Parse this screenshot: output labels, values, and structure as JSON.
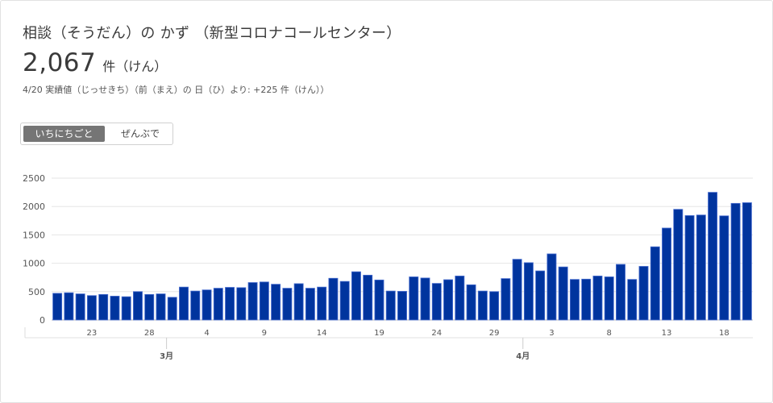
{
  "header": {
    "title": "相談（そうだん）の かず （新型コロナコールセンター）",
    "total_value": "2,067",
    "total_unit": "件（けん）",
    "subline": "4/20 実績値（じっせきち）（前（まえ）の 日（ひ）より: +225 件（けん））"
  },
  "toggle": {
    "daily_label": "いちにちごと",
    "cumulative_label": "ぜんぶで",
    "selected": "daily"
  },
  "colors": {
    "bar": "#00349e",
    "bar_stroke": "#4a6fd0",
    "grid": "#e6e6e6"
  },
  "chart_data": {
    "type": "bar",
    "title": "",
    "xlabel": "",
    "ylabel": "",
    "ylim": [
      0,
      2500
    ],
    "yticks": [
      0,
      500,
      1000,
      1500,
      2000,
      2500
    ],
    "grid": true,
    "x_start": "2020-02-20",
    "dates": [
      "2/20",
      "2/21",
      "2/22",
      "2/23",
      "2/24",
      "2/25",
      "2/26",
      "2/27",
      "2/28",
      "2/29",
      "3/1",
      "3/2",
      "3/3",
      "3/4",
      "3/5",
      "3/6",
      "3/7",
      "3/8",
      "3/9",
      "3/10",
      "3/11",
      "3/12",
      "3/13",
      "3/14",
      "3/15",
      "3/16",
      "3/17",
      "3/18",
      "3/19",
      "3/20",
      "3/21",
      "3/22",
      "3/23",
      "3/24",
      "3/25",
      "3/26",
      "3/27",
      "3/28",
      "3/29",
      "3/30",
      "3/31",
      "4/1",
      "4/2",
      "4/3",
      "4/4",
      "4/5",
      "4/6",
      "4/7",
      "4/8",
      "4/9",
      "4/10",
      "4/11",
      "4/12",
      "4/13",
      "4/14",
      "4/15",
      "4/16",
      "4/17",
      "4/18",
      "4/19",
      "4/20"
    ],
    "values": [
      470,
      480,
      460,
      430,
      450,
      420,
      410,
      500,
      450,
      460,
      400,
      580,
      510,
      530,
      560,
      575,
      570,
      660,
      670,
      630,
      560,
      640,
      560,
      580,
      735,
      680,
      850,
      790,
      705,
      510,
      505,
      760,
      740,
      645,
      710,
      775,
      620,
      510,
      500,
      730,
      1070,
      1010,
      865,
      1165,
      935,
      715,
      720,
      775,
      760,
      980,
      715,
      945,
      1290,
      1620,
      1950,
      1840,
      1850,
      2250,
      1835,
      2055,
      2067
    ],
    "x_tick_labels": [
      "23",
      "28",
      "4",
      "9",
      "14",
      "19",
      "24",
      "29",
      "3",
      "8",
      "13",
      "18"
    ],
    "x_tick_index": [
      3,
      8,
      13,
      18,
      23,
      28,
      33,
      38,
      43,
      48,
      53,
      58
    ],
    "month_labels": [
      "3月",
      "4月"
    ],
    "month_index": [
      10,
      41
    ]
  }
}
